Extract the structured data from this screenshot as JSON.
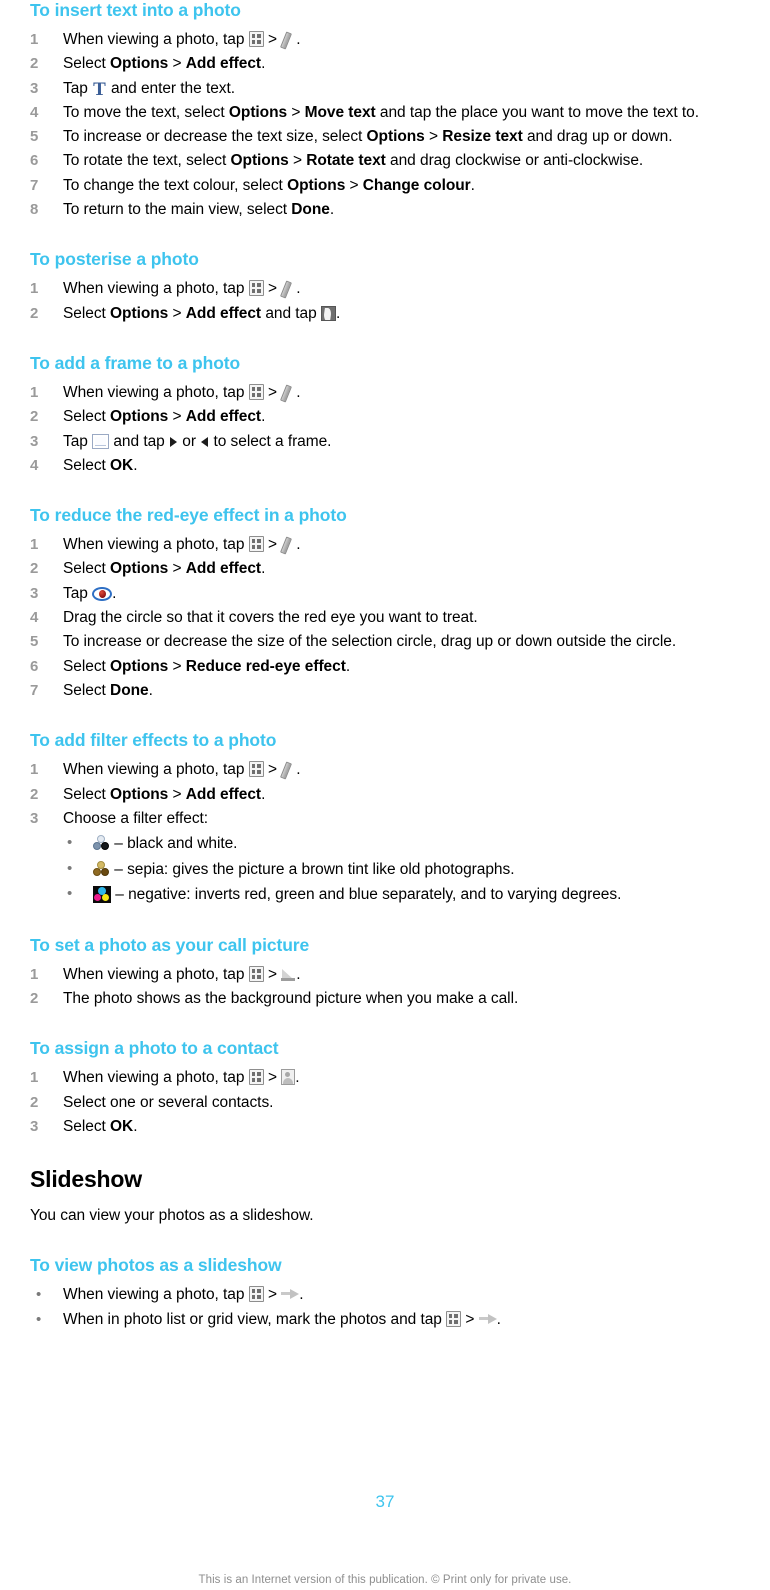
{
  "sections": [
    {
      "id": "insert-text",
      "heading": "To insert text into a photo",
      "steps": [
        {
          "num": "1",
          "pre": "When viewing a photo, tap ",
          "icons": [
            "gallery",
            "gt",
            "pencil"
          ],
          "post": "."
        },
        {
          "num": "2",
          "text_parts": [
            {
              "t": "Select "
            },
            {
              "t": "Options",
              "b": true
            },
            {
              "t": " > ",
              "gt": true
            },
            {
              "t": "Add effect",
              "b": true
            },
            {
              "t": "."
            }
          ]
        },
        {
          "num": "3",
          "pre": "Tap ",
          "icons": [
            "textT"
          ],
          "post": " and enter the text."
        },
        {
          "num": "4",
          "text_parts": [
            {
              "t": "To move the text, select "
            },
            {
              "t": "Options",
              "b": true
            },
            {
              "t": " > ",
              "gt": true
            },
            {
              "t": "Move text",
              "b": true
            },
            {
              "t": " and tap the place you want to move the text to."
            }
          ]
        },
        {
          "num": "5",
          "text_parts": [
            {
              "t": "To increase or decrease the text size, select "
            },
            {
              "t": "Options",
              "b": true
            },
            {
              "t": " > ",
              "gt": true
            },
            {
              "t": "Resize text",
              "b": true
            },
            {
              "t": " and drag up or down."
            }
          ]
        },
        {
          "num": "6",
          "text_parts": [
            {
              "t": "To rotate the text, select "
            },
            {
              "t": "Options",
              "b": true
            },
            {
              "t": " > ",
              "gt": true
            },
            {
              "t": "Rotate text",
              "b": true
            },
            {
              "t": " and drag clockwise or anti-clockwise."
            }
          ]
        },
        {
          "num": "7",
          "text_parts": [
            {
              "t": "To change the text colour, select "
            },
            {
              "t": "Options",
              "b": true
            },
            {
              "t": " > ",
              "gt": true
            },
            {
              "t": "Change colour",
              "b": true
            },
            {
              "t": "."
            }
          ]
        },
        {
          "num": "8",
          "text_parts": [
            {
              "t": "To return to the main view, select "
            },
            {
              "t": "Done",
              "b": true
            },
            {
              "t": "."
            }
          ]
        }
      ]
    },
    {
      "id": "posterise",
      "heading": "To posterise a photo",
      "steps": [
        {
          "num": "1",
          "pre": "When viewing a photo, tap ",
          "icons": [
            "gallery",
            "gt",
            "pencil"
          ],
          "post": "."
        },
        {
          "num": "2",
          "pre": "",
          "post": "."
        }
      ]
    },
    {
      "id": "add-frame",
      "heading": "To add a frame to a photo",
      "steps": []
    },
    {
      "id": "red-eye",
      "heading": "To reduce the red-eye effect in a photo",
      "steps": []
    },
    {
      "id": "filter-effects",
      "heading": "To add filter effects to a photo",
      "steps": []
    },
    {
      "id": "call-picture",
      "heading": "To set a photo as your call picture",
      "steps": []
    },
    {
      "id": "assign-contact",
      "heading": "To assign a photo to a contact",
      "steps": []
    },
    {
      "id": "view-slideshow",
      "heading": "To view photos as a slideshow",
      "steps": []
    }
  ],
  "headings": {
    "insert_text": "To insert text into a photo",
    "posterise": "To posterise a photo",
    "add_frame": "To add a frame to a photo",
    "red_eye": "To reduce the red-eye effect in a photo",
    "filter_effects": "To add filter effects to a photo",
    "call_picture": "To set a photo as your call picture",
    "assign_contact": "To assign a photo to a contact",
    "slideshow_major": "Slideshow",
    "view_slideshow": "To view photos as a slideshow"
  },
  "common": {
    "when_viewing": "When viewing a photo, tap ",
    "select": "Select ",
    "options": "Options",
    "gt": " > ",
    "add_effect": "Add effect",
    "period": ".",
    "tap": "Tap ",
    "and_tap": " and tap ",
    "done": "Done",
    "ok": "OK"
  },
  "insert_text": {
    "s1_pre": "When viewing a photo, tap ",
    "s1_post": ".",
    "s2_a": "Select ",
    "s2_options": "Options",
    "s2_gt": " > ",
    "s2_effect": "Add effect",
    "s2_end": ".",
    "s3_pre": "Tap ",
    "s3_icon": "T",
    "s3_post": " and enter the text.",
    "s4_a": "To move the text, select ",
    "s4_options": "Options",
    "s4_gt": " > ",
    "s4_cmd": "Move text",
    "s4_end": " and tap the place you want to move the text to.",
    "s5_a": "To increase or decrease the text size, select ",
    "s5_options": "Options",
    "s5_gt": " > ",
    "s5_cmd": "Resize text",
    "s5_end": " and drag up or down.",
    "s6_a": "To rotate the text, select ",
    "s6_options": "Options",
    "s6_gt": " > ",
    "s6_cmd": "Rotate text",
    "s6_end": " and drag clockwise or anti-clockwise.",
    "s7_a": "To change the text colour, select ",
    "s7_options": "Options",
    "s7_gt": " > ",
    "s7_cmd": "Change colour",
    "s7_end": ".",
    "s8_a": "To return to the main view, select ",
    "s8_cmd": "Done",
    "s8_end": "."
  },
  "posterise": {
    "s1_pre": "When viewing a photo, tap ",
    "s1_post": ".",
    "s2_a": "Select ",
    "s2_options": "Options",
    "s2_gt": " > ",
    "s2_effect": "Add effect",
    "s2_mid": " and tap ",
    "s2_end": "."
  },
  "add_frame": {
    "s1_pre": "When viewing a photo, tap ",
    "s1_post": ".",
    "s2_a": "Select ",
    "s2_options": "Options",
    "s2_gt": " > ",
    "s2_effect": "Add effect",
    "s2_end": ".",
    "s3_pre": "Tap ",
    "s3_mid": " and tap ",
    "s3_or": " or ",
    "s3_end": " to select a frame.",
    "s4_a": "Select ",
    "s4_cmd": "OK",
    "s4_end": "."
  },
  "red_eye": {
    "s1_pre": "When viewing a photo, tap ",
    "s1_post": ".",
    "s2_a": "Select ",
    "s2_options": "Options",
    "s2_gt": " > ",
    "s2_effect": "Add effect",
    "s2_end": ".",
    "s3_pre": "Tap ",
    "s3_end": ".",
    "s4": "Drag the circle so that it covers the red eye you want to treat.",
    "s5": "To increase or decrease the size of the selection circle, drag up or down outside the circle.",
    "s6_a": "Select ",
    "s6_options": "Options",
    "s6_gt": " > ",
    "s6_cmd": "Reduce red-eye effect",
    "s6_end": ".",
    "s7_a": "Select ",
    "s7_cmd": "Done",
    "s7_end": "."
  },
  "filter_effects": {
    "s1_pre": "When viewing a photo, tap ",
    "s1_post": ".",
    "s2_a": "Select ",
    "s2_options": "Options",
    "s2_gt": " > ",
    "s2_effect": "Add effect",
    "s2_end": ".",
    "s3": "Choose a filter effect:",
    "b1": " – black and white.",
    "b2": " – sepia: gives the picture a brown tint like old photographs.",
    "b3": " – negative: inverts red, green and blue separately, and to varying degrees."
  },
  "call_picture": {
    "s1_pre": "When viewing a photo, tap ",
    "s1_post": ".",
    "s2": "The photo shows as the background picture when you make a call."
  },
  "assign_contact": {
    "s1_pre": "When viewing a photo, tap ",
    "s1_post": ".",
    "s2": "Select one or several contacts.",
    "s3_a": "Select ",
    "s3_cmd": "OK",
    "s3_end": "."
  },
  "slideshow": {
    "intro": "You can view your photos as a slideshow.",
    "b1_pre": "When viewing a photo, tap ",
    "b1_post": ".",
    "b2_pre": "When in photo list or grid view, mark the photos and tap ",
    "b2_post": "."
  },
  "numbers": {
    "n1": "1",
    "n2": "2",
    "n3": "3",
    "n4": "4",
    "n5": "5",
    "n6": "6",
    "n7": "7",
    "n8": "8"
  },
  "bullet": "•",
  "footer": {
    "page_number": "37",
    "note": "This is an Internet version of this publication. © Print only for private use."
  },
  "colors": {
    "heading": "#3ec4ee",
    "step_number": "#9a9a9a",
    "body": "#000000",
    "footer_note": "#8e8e8e"
  }
}
